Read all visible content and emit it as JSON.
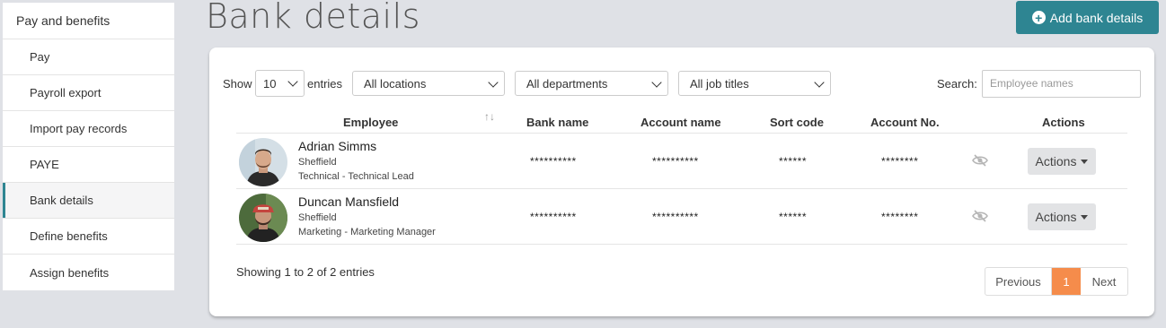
{
  "sidebar": {
    "heading": "Pay and benefits",
    "items": [
      {
        "label": "Pay"
      },
      {
        "label": "Payroll export"
      },
      {
        "label": "Import pay records"
      },
      {
        "label": "PAYE"
      },
      {
        "label": "Bank details"
      },
      {
        "label": "Define benefits"
      },
      {
        "label": "Assign benefits"
      }
    ]
  },
  "page": {
    "title": "Bank details",
    "add_button": "Add bank details",
    "accent_color": "#2e8592",
    "page_active_color": "#f58c4b"
  },
  "filters": {
    "show_label": "Show",
    "entries_value": "10",
    "entries_label": "entries",
    "locations": "All locations",
    "departments": "All departments",
    "job_titles": "All job titles",
    "search_label": "Search:",
    "search_placeholder": "Employee names"
  },
  "table": {
    "headers": [
      "Employee",
      "Bank name",
      "Account name",
      "Sort code",
      "Account No.",
      "Actions"
    ],
    "rows": [
      {
        "name": "Adrian Simms",
        "location": "Sheffield",
        "department": "Technical - Technical Lead",
        "bank_name": "**********",
        "account_name": "**********",
        "sort_code": "******",
        "account_no": "********",
        "actions": "Actions"
      },
      {
        "name": "Duncan Mansfield",
        "location": "Sheffield",
        "department": "Marketing - Marketing Manager",
        "bank_name": "**********",
        "account_name": "**********",
        "sort_code": "******",
        "account_no": "********",
        "actions": "Actions"
      }
    ]
  },
  "footer": {
    "info": "Showing 1 to 2 of 2 entries",
    "previous": "Previous",
    "page": "1",
    "next": "Next"
  }
}
